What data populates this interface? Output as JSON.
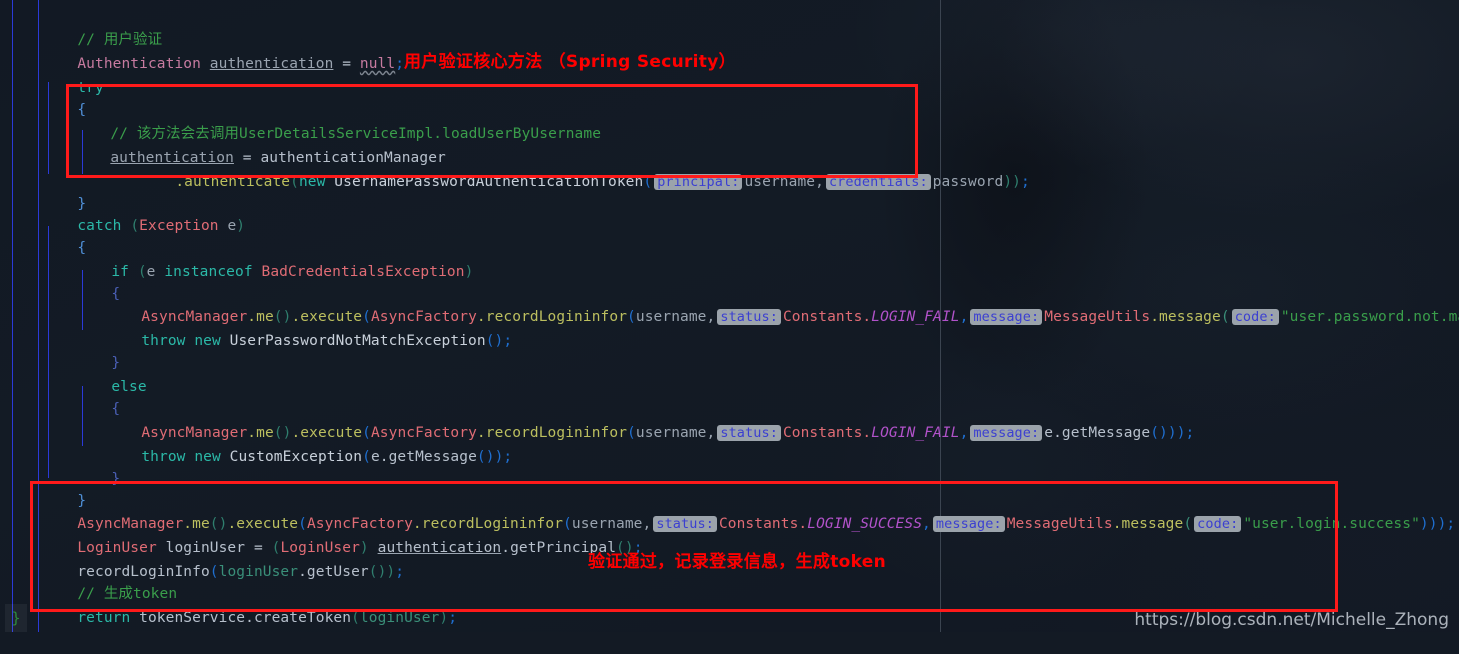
{
  "editor": {
    "background_color": "#131a24",
    "annotation_color": "#ff0000",
    "guide_color": "#2b3ad8",
    "margin_guide_color": "#3b4450",
    "bottom_brace": "}"
  },
  "annotations": [
    {
      "id": "top",
      "text": "用户验证核心方法 （Spring Security）"
    },
    {
      "id": "bottom",
      "text": "验证通过，记录登录信息，生成token"
    }
  ],
  "watermark": {
    "text": "https://blog.csdn.net/Michelle_Zhong"
  },
  "code": {
    "l01_comment": "// 用户验证",
    "l02_type": "Authentication",
    "l02_var": "authentication",
    "l02_eq": " = ",
    "l02_null": "null",
    "l02_semi": ";",
    "l03_try": "try",
    "l04_brace": "{",
    "l05_comment_cn": "// 该方法会去调用",
    "l05_comment_en": "UserDetailsServiceImpl.loadUserByUsername",
    "l06_var": "authentication",
    "l06_rest": " = authenticationManager",
    "l07_dot": ".authenticate",
    "l07_lparen": "(",
    "l07_new": "new",
    "l07_cls": " UsernamePasswordAuthenticationToken",
    "l07_lparen2": "(",
    "l07_hint1": "principal:",
    "l07_arg1": "username,",
    "l07_hint2": "credentials:",
    "l07_arg2": "password",
    "l07_close": "))",
    "l07_semi": ";",
    "l08_brace": "}",
    "l09_catch": "catch",
    "l09_lparen": " (",
    "l09_cls": "Exception",
    "l09_var": " e",
    "l09_rparen": ")",
    "l10_brace": "{",
    "l11_if": "if",
    "l11_lparen": " (",
    "l11_var": "e",
    "l11_instanceof": " instanceof",
    "l11_cls": " BadCredentialsException",
    "l11_rparen": ")",
    "l12_brace": "{",
    "l13_a": "AsyncManager",
    "l13_dot_me": ".me",
    "l13_p1": "()",
    "l13_exec": ".execute",
    "l13_p2": "(",
    "l13_b": "AsyncFactory",
    "l13_rec": ".recordLogininfor",
    "l13_p3": "(",
    "l13_username": "username,",
    "l13_hint_status": "status:",
    "l13_constants": "Constants.",
    "l13_login_fail": "LOGIN_FAIL",
    "l13_comma": ",",
    "l13_hint_message": "message:",
    "l13_msgutils": "MessageUtils",
    "l13_msg": ".message",
    "l13_p4": "(",
    "l13_hint_code": "code:",
    "l13_str": "\"user.password.not.match\"",
    "l13_close": ")))",
    "l13_semi": ";",
    "l14_throw": "throw",
    "l14_new": " new",
    "l14_cls": " UserPasswordNotMatchException",
    "l14_p": "()",
    "l14_semi": ";",
    "l15_brace": "}",
    "l16_else": "else",
    "l17_brace": "{",
    "l18_a": "AsyncManager",
    "l18_dot_me": ".me",
    "l18_p1": "()",
    "l18_exec": ".execute",
    "l18_p2": "(",
    "l18_b": "AsyncFactory",
    "l18_rec": ".recordLogininfor",
    "l18_p3": "(",
    "l18_username": "username,",
    "l18_hint_status": "status:",
    "l18_constants": "Constants.",
    "l18_login_fail": "LOGIN_FAIL",
    "l18_comma": ",",
    "l18_hint_message": "message:",
    "l18_egetmsg": "e.getMessage",
    "l18_close": "()))",
    "l18_semi": ";",
    "l19_throw": "throw",
    "l19_new": " new",
    "l19_cls": " CustomException",
    "l19_p1": "(",
    "l19_arg": "e.getMessage",
    "l19_p2": "())",
    "l19_semi": ";",
    "l20_brace": "}",
    "l21_brace": "}",
    "l22_a": "AsyncManager",
    "l22_dot_me": ".me",
    "l22_p1": "()",
    "l22_exec": ".execute",
    "l22_p2": "(",
    "l22_b": "AsyncFactory",
    "l22_rec": ".recordLogininfor",
    "l22_p3": "(",
    "l22_username": "username,",
    "l22_hint_status": "status:",
    "l22_constants": "Constants.",
    "l22_login_success": "LOGIN_SUCCESS",
    "l22_comma": ",",
    "l22_hint_message": "message:",
    "l22_msgutils": "MessageUtils",
    "l22_msg": ".message",
    "l22_p4": "(",
    "l22_hint_code": "code:",
    "l22_str": "\"user.login.success\"",
    "l22_close": ")))",
    "l22_semi": ";",
    "l23_cls": "LoginUser",
    "l23_var": " loginUser",
    "l23_eq": " = ",
    "l23_cast_l": "(",
    "l23_cast": "LoginUser",
    "l23_cast_r": ")",
    "l23_auth": "authentication",
    "l23_getp": ".getPrincipal",
    "l23_p": "()",
    "l23_semi": ";",
    "l24_rec": "recordLoginInfo",
    "l24_p1": "(",
    "l24_var": "loginUser",
    "l24_getuser": ".getUser",
    "l24_p2": "())",
    "l24_semi": ";",
    "l25_comment": "// 生成token",
    "l26_return": "return",
    "l26_svc": " tokenService",
    "l26_create": ".createToken",
    "l26_p1": "(",
    "l26_var": "loginUser",
    "l26_p2": ")",
    "l26_semi": ";"
  }
}
